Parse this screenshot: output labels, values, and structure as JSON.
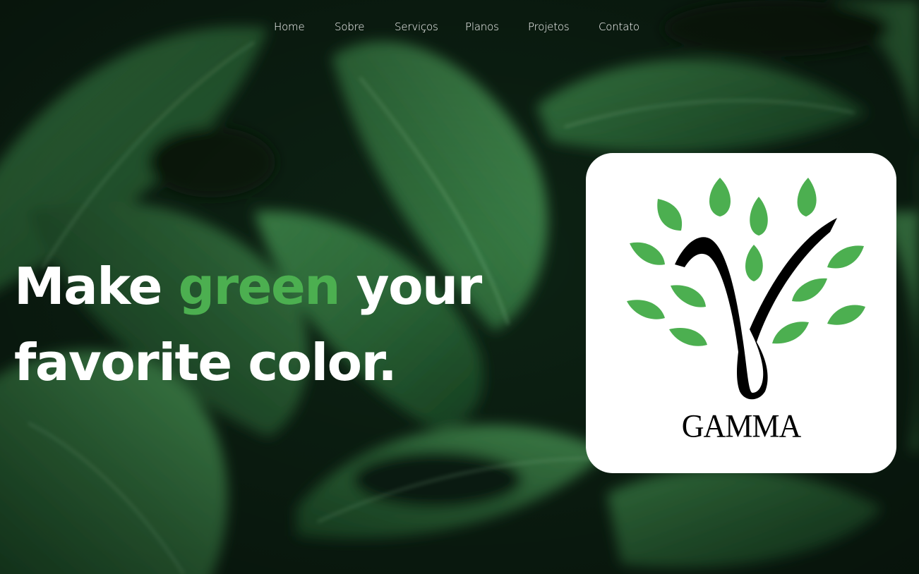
{
  "nav": {
    "items": [
      {
        "label": "Home"
      },
      {
        "label": "Sobre"
      },
      {
        "label": "Serviços"
      },
      {
        "label": "Planos"
      },
      {
        "label": "Projetos"
      },
      {
        "label": "Contato"
      }
    ]
  },
  "hero": {
    "title_part1": "Make ",
    "title_accent": "green",
    "title_part2": " your favorite color."
  },
  "logo": {
    "brand_text": "GAMMA"
  },
  "colors": {
    "accent": "#4caf50",
    "leaf_green": "#4caf50",
    "text": "#ffffff",
    "card_background": "#ffffff"
  }
}
